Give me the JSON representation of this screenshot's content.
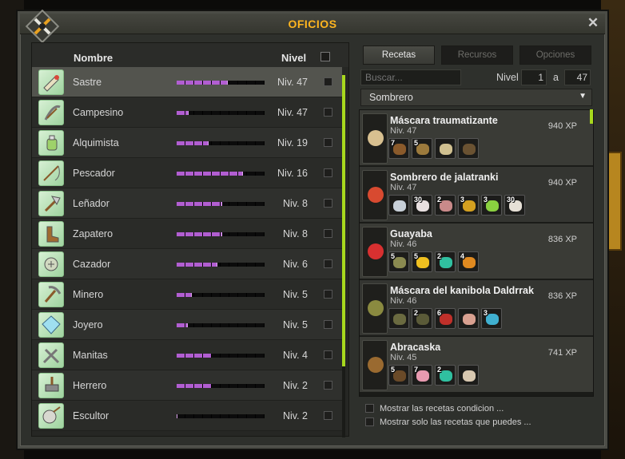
{
  "window": {
    "title": "OFICIOS",
    "close": "✕"
  },
  "left": {
    "headers": {
      "name": "Nombre",
      "level": "Nivel"
    },
    "jobs": [
      {
        "name": "Sastre",
        "level": "Niv. 47",
        "progress": 0.58,
        "icon": "tailor-icon",
        "selected": true
      },
      {
        "name": "Campesino",
        "level": "Niv. 47",
        "progress": 0.14
      },
      {
        "name": "Alquimista",
        "level": "Niv. 19",
        "progress": 0.36
      },
      {
        "name": "Pescador",
        "level": "Niv. 16",
        "progress": 0.75
      },
      {
        "name": "Leñador",
        "level": "Niv. 8",
        "progress": 0.52
      },
      {
        "name": "Zapatero",
        "level": "Niv. 8",
        "progress": 0.52
      },
      {
        "name": "Cazador",
        "level": "Niv. 6",
        "progress": 0.46
      },
      {
        "name": "Minero",
        "level": "Niv. 5",
        "progress": 0.17
      },
      {
        "name": "Joyero",
        "level": "Niv. 5",
        "progress": 0.13
      },
      {
        "name": "Manitas",
        "level": "Niv. 4",
        "progress": 0.4
      },
      {
        "name": "Herrero",
        "level": "Niv. 2",
        "progress": 0.4
      },
      {
        "name": "Escultor",
        "level": "Niv. 2",
        "progress": 0.0
      }
    ]
  },
  "tabs": [
    "Recetas",
    "Recursos",
    "Opciones"
  ],
  "filter": {
    "search_placeholder": "Buscar...",
    "level_label": "Nivel",
    "level_min": "1",
    "separator": "a",
    "level_max": "47"
  },
  "category": {
    "selected": "Sombrero"
  },
  "recipes": [
    {
      "name": "Máscara traumatizante",
      "level": "Niv. 47",
      "xp": "940 XP",
      "ingredients": [
        {
          "qty": "7",
          "color": "#8a5a2b"
        },
        {
          "qty": "5",
          "color": "#9c7a3c"
        },
        {
          "qty": "",
          "color": "#d0c090"
        },
        {
          "qty": "",
          "color": "#6a5232"
        }
      ]
    },
    {
      "name": "Sombrero de jalatranki",
      "level": "Niv. 47",
      "xp": "940 XP",
      "ingredients": [
        {
          "qty": "",
          "color": "#c8d0d8"
        },
        {
          "qty": "30",
          "color": "#e8e0e0"
        },
        {
          "qty": "2",
          "color": "#c98a8a"
        },
        {
          "qty": "3",
          "color": "#d4a020"
        },
        {
          "qty": "3",
          "color": "#8ad040"
        },
        {
          "qty": "30",
          "color": "#e6e0d6"
        }
      ]
    },
    {
      "name": "Guayaba",
      "level": "Niv. 46",
      "xp": "836 XP",
      "ingredients": [
        {
          "qty": "5",
          "color": "#8a8a50"
        },
        {
          "qty": "5",
          "color": "#f0c020"
        },
        {
          "qty": "2",
          "color": "#30c0a0"
        },
        {
          "qty": "4",
          "color": "#e08a20"
        }
      ]
    },
    {
      "name": "Máscara del kanibola Daldrrak",
      "level": "Niv. 46",
      "xp": "836 XP",
      "ingredients": [
        {
          "qty": "",
          "color": "#6a6a40"
        },
        {
          "qty": "2",
          "color": "#5a5a38"
        },
        {
          "qty": "6",
          "color": "#c0302a"
        },
        {
          "qty": "",
          "color": "#d8a090"
        },
        {
          "qty": "3",
          "color": "#40b0d0"
        }
      ]
    },
    {
      "name": "Abracaska",
      "level": "Niv. 45",
      "xp": "741 XP",
      "ingredients": [
        {
          "qty": "5",
          "color": "#6a4a28"
        },
        {
          "qty": "7",
          "color": "#e89ab0"
        },
        {
          "qty": "2",
          "color": "#30c0a0"
        },
        {
          "qty": "",
          "color": "#d8c8b0"
        }
      ]
    }
  ],
  "options": {
    "conditional": "Mostrar las recetas condicion ...",
    "can_craft": "Mostrar solo las recetas que puedes ..."
  },
  "colors": {
    "accent": "#ffb51f",
    "progress": "#b25ed2",
    "scroll": "#a7d81d"
  }
}
